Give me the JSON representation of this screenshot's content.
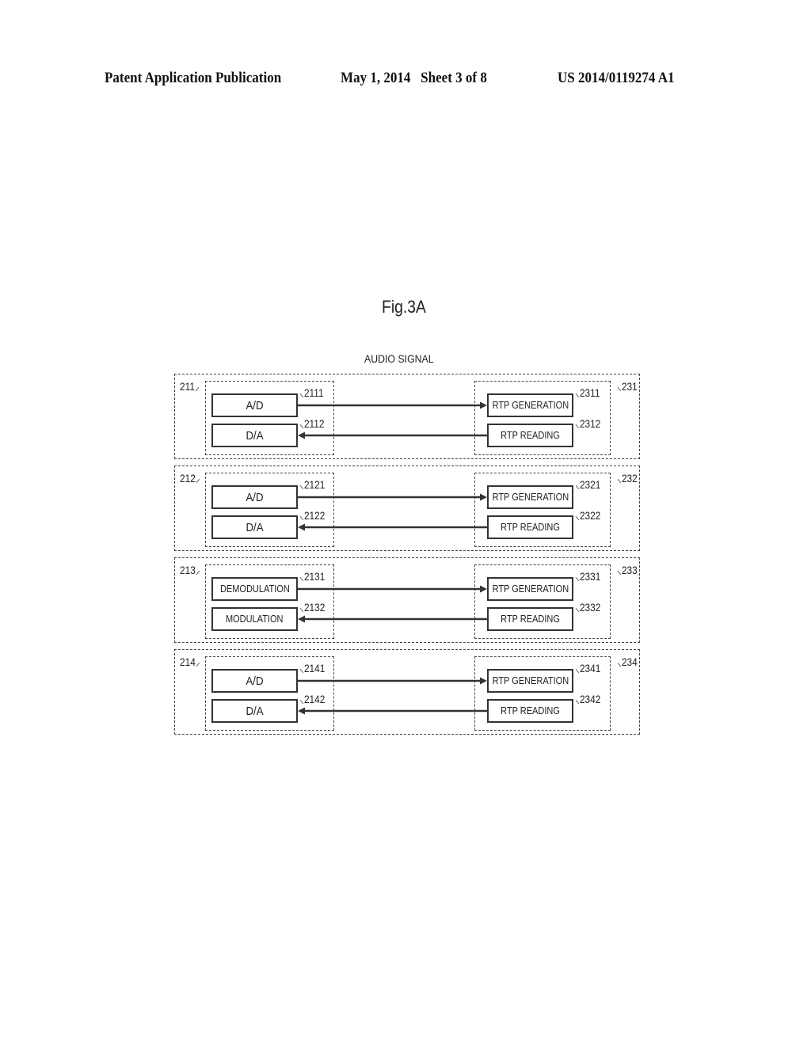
{
  "header": {
    "publication": "Patent Application Publication",
    "date_sheet": "May 1, 2014   Sheet 3 of 8",
    "patent_number": "US 2014/0119274 A1"
  },
  "figure": {
    "title": "Fig.3A",
    "signal_label": "AUDIO SIGNAL"
  },
  "rows": [
    {
      "left_ref": "211",
      "right_ref": "231",
      "left_blocks": [
        {
          "label": "A/D",
          "ref": "2111"
        },
        {
          "label": "D/A",
          "ref": "2112"
        }
      ],
      "right_blocks": [
        {
          "label": "RTP GENERATION",
          "ref": "2311"
        },
        {
          "label": "RTP READING",
          "ref": "2312"
        }
      ]
    },
    {
      "left_ref": "212",
      "right_ref": "232",
      "left_blocks": [
        {
          "label": "A/D",
          "ref": "2121"
        },
        {
          "label": "D/A",
          "ref": "2122"
        }
      ],
      "right_blocks": [
        {
          "label": "RTP GENERATION",
          "ref": "2321"
        },
        {
          "label": "RTP READING",
          "ref": "2322"
        }
      ]
    },
    {
      "left_ref": "213",
      "right_ref": "233",
      "left_blocks": [
        {
          "label": "DEMODULATION",
          "ref": "2131"
        },
        {
          "label": "MODULATION",
          "ref": "2132"
        }
      ],
      "right_blocks": [
        {
          "label": "RTP GENERATION",
          "ref": "2331"
        },
        {
          "label": "RTP READING",
          "ref": "2332"
        }
      ]
    },
    {
      "left_ref": "214",
      "right_ref": "234",
      "left_blocks": [
        {
          "label": "A/D",
          "ref": "2141"
        },
        {
          "label": "D/A",
          "ref": "2142"
        }
      ],
      "right_blocks": [
        {
          "label": "RTP GENERATION",
          "ref": "2341"
        },
        {
          "label": "RTP READING",
          "ref": "2342"
        }
      ]
    }
  ]
}
